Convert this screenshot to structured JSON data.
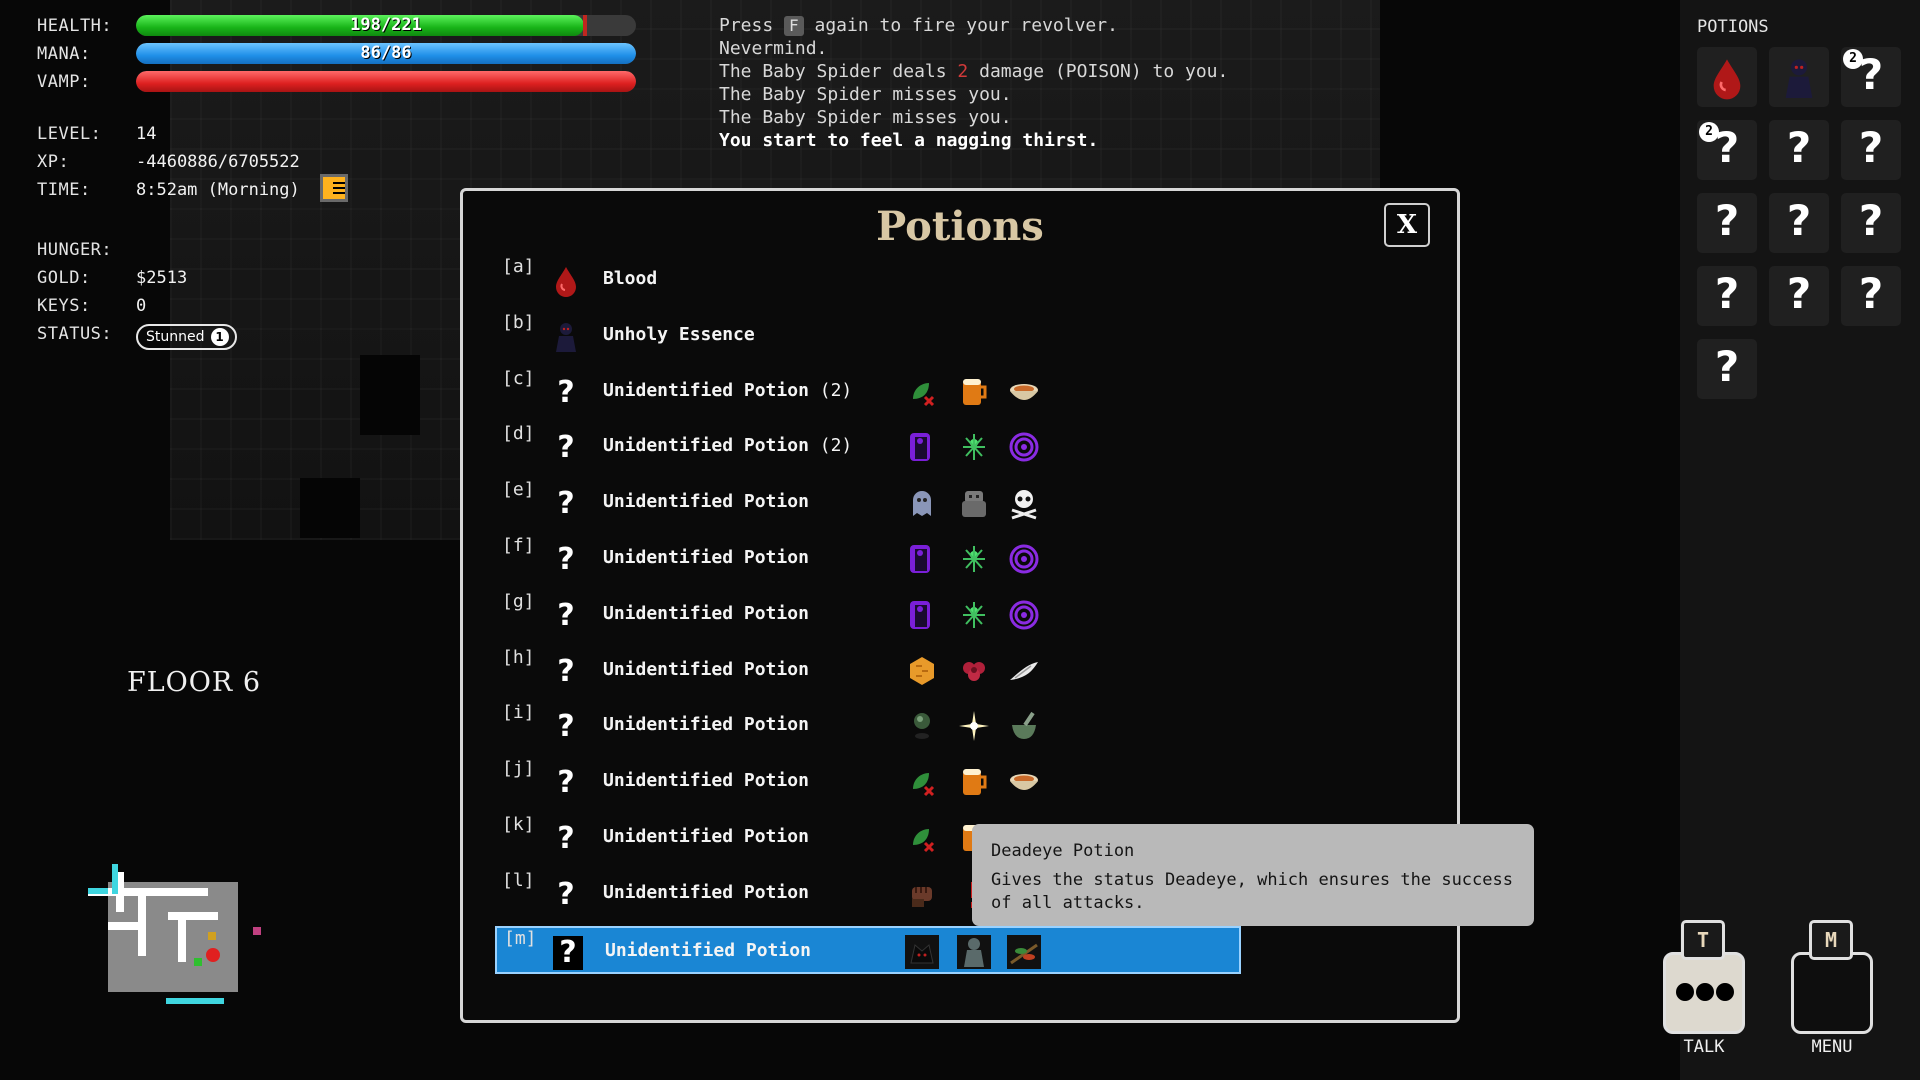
{
  "stats": {
    "health_label": "HEALTH:",
    "health_text": "198/221",
    "health_fraction": 0.896,
    "mana_label": "MANA:",
    "mana_text": "86/86",
    "mana_fraction": 1.0,
    "vamp_label": "VAMP:",
    "vamp_fraction": 1.0,
    "level_label": "LEVEL:",
    "level_value": "14",
    "xp_label": "XP:",
    "xp_value": "-4460886/6705522",
    "time_label": "TIME:",
    "time_value": "8:52am (Morning)",
    "hunger_label": "HUNGER:",
    "gold_label": "GOLD:",
    "gold_value": "$2513",
    "keys_label": "KEYS:",
    "keys_value": "0",
    "status_label": "STATUS:",
    "status_name": "Stunned",
    "status_count": "1"
  },
  "floor": "FLOOR 6",
  "log": {
    "line1_a": "Press ",
    "line1_key": "F",
    "line1_b": " again to fire your revolver.",
    "line2": "Nevermind.",
    "line3_a": "The Baby Spider deals ",
    "line3_dmg": "2",
    "line3_b": " damage (POISON) to you.",
    "line4": "The Baby Spider misses you.",
    "line5": "The Baby Spider misses you.",
    "line6": "You start to feel a nagging thirst."
  },
  "modal": {
    "title": "Potions",
    "close": "X",
    "rows": [
      {
        "key": "[a]",
        "name": "Blood",
        "count": "",
        "icon": "blood-drop-icon",
        "effects": []
      },
      {
        "key": "[b]",
        "name": "Unholy Essence",
        "count": "",
        "icon": "shadow-figure-icon",
        "effects": []
      },
      {
        "key": "[c]",
        "name": "Unidentified Potion",
        "count": " (2)",
        "icon": "question-icon",
        "effects": [
          "poison-leaf-icon",
          "beer-mug-icon",
          "food-bowl-icon"
        ]
      },
      {
        "key": "[d]",
        "name": "Unidentified Potion",
        "count": " (2)",
        "icon": "question-icon",
        "effects": [
          "purple-door-icon",
          "green-sparkle-icon",
          "purple-spiral-icon"
        ]
      },
      {
        "key": "[e]",
        "name": "Unidentified Potion",
        "count": "",
        "icon": "question-icon",
        "effects": [
          "ghost-icon",
          "stone-golem-icon",
          "skull-crossbones-icon"
        ]
      },
      {
        "key": "[f]",
        "name": "Unidentified Potion",
        "count": "",
        "icon": "question-icon",
        "effects": [
          "purple-door-icon",
          "green-sparkle-icon",
          "purple-spiral-icon"
        ]
      },
      {
        "key": "[g]",
        "name": "Unidentified Potion",
        "count": "",
        "icon": "question-icon",
        "effects": [
          "purple-door-icon",
          "green-sparkle-icon",
          "purple-spiral-icon"
        ]
      },
      {
        "key": "[h]",
        "name": "Unidentified Potion",
        "count": "",
        "icon": "question-icon",
        "effects": [
          "honeycomb-icon",
          "red-flower-icon",
          "wing-icon"
        ]
      },
      {
        "key": "[i]",
        "name": "Unidentified Potion",
        "count": "",
        "icon": "question-icon",
        "effects": [
          "green-orb-icon",
          "light-burst-icon",
          "mortar-pestle-icon"
        ]
      },
      {
        "key": "[j]",
        "name": "Unidentified Potion",
        "count": "",
        "icon": "question-icon",
        "effects": [
          "poison-leaf-icon",
          "beer-mug-icon",
          "food-bowl-icon"
        ]
      },
      {
        "key": "[k]",
        "name": "Unidentified Potion",
        "count": "",
        "icon": "question-icon",
        "effects": [
          "poison-leaf-icon",
          "beer-mug-icon"
        ]
      },
      {
        "key": "[l]",
        "name": "Unidentified Potion",
        "count": "",
        "icon": "question-icon",
        "effects": [
          "fist-icon",
          "exclamation-icon"
        ]
      },
      {
        "key": "[m]",
        "name": "Unidentified Potion",
        "count": "",
        "icon": "question-icon",
        "effects": [
          "dark-creature-icon",
          "stone-figure-icon",
          "herb-icon"
        ],
        "selected": true
      }
    ]
  },
  "tooltip": {
    "title": "Deadeye Potion",
    "desc": "Gives the status Deadeye, which ensures the success of all attacks."
  },
  "potions_panel": {
    "header": "POTIONS",
    "cells": [
      {
        "icon": "blood-drop-icon",
        "count": ""
      },
      {
        "icon": "shadow-figure-icon",
        "count": ""
      },
      {
        "icon": "question-icon",
        "count": "2"
      },
      {
        "icon": "question-icon",
        "count": "2"
      },
      {
        "icon": "question-icon",
        "count": ""
      },
      {
        "icon": "question-icon",
        "count": ""
      },
      {
        "icon": "question-icon",
        "count": ""
      },
      {
        "icon": "question-icon",
        "count": ""
      },
      {
        "icon": "question-icon",
        "count": ""
      },
      {
        "icon": "question-icon",
        "count": ""
      },
      {
        "icon": "question-icon",
        "count": ""
      },
      {
        "icon": "question-icon",
        "count": ""
      },
      {
        "icon": "question-icon",
        "count": ""
      }
    ]
  },
  "controls": {
    "talk_key": "T",
    "talk_label": "TALK",
    "menu_key": "M",
    "menu_label": "MENU"
  },
  "colors": {
    "modal_title": "#d8c7a4",
    "selected_row": "#1a86d4",
    "damage": "#d13a3a"
  }
}
